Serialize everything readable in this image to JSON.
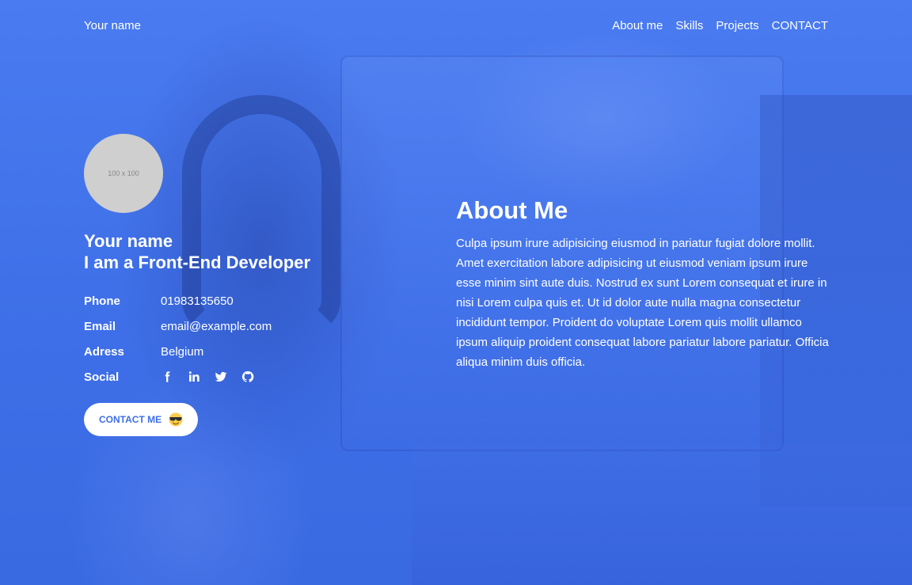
{
  "nav": {
    "brand": "Your name",
    "links": [
      {
        "label": "About me"
      },
      {
        "label": "Skills"
      },
      {
        "label": "Projects"
      },
      {
        "label": "CONTACT"
      }
    ]
  },
  "profile": {
    "avatar_placeholder": "100 x 100",
    "name": "Your name",
    "role": "I am a Front-End Developer",
    "info": {
      "phone": {
        "label": "Phone",
        "value": "01983135650"
      },
      "email": {
        "label": "Email",
        "value": "email@example.com"
      },
      "address": {
        "label": "Adress",
        "value": "Belgium"
      },
      "social": {
        "label": "Social",
        "icons": [
          "facebook-icon",
          "linkedin-icon",
          "twitter-icon",
          "github-icon"
        ]
      }
    },
    "contact_button": {
      "label": "CONTACT ME",
      "icon": "sunglasses-emoji-icon"
    }
  },
  "about": {
    "title": "About Me",
    "text": "Culpa ipsum irure adipisicing eiusmod in pariatur fugiat dolore mollit. Amet exercitation labore adipisicing ut eiusmod veniam ipsum irure esse minim sint aute duis. Nostrud ex sunt Lorem consequat et irure in nisi Lorem culpa quis et. Ut id dolor aute nulla magna consectetur incididunt tempor. Proident do voluptate Lorem quis mollit ullamco ipsum aliquip proident consequat labore pariatur labore pariatur. Officia aliqua minim duis officia."
  },
  "colors": {
    "overlay_blue": "#3f72ea",
    "text": "#ffffff",
    "button_text": "#3d6fe8",
    "avatar_bg": "#cfcfcf"
  }
}
